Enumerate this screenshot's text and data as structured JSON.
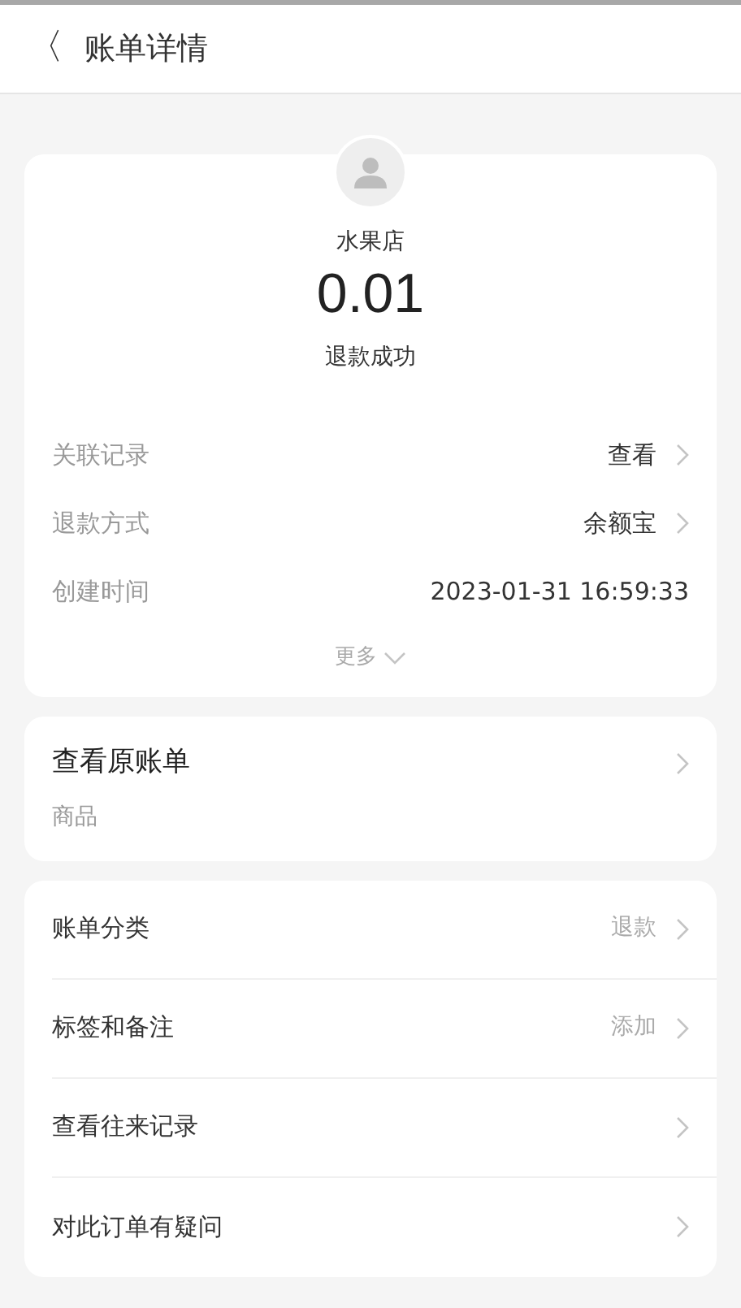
{
  "header": {
    "back_icon": "〈",
    "title": "账单详情"
  },
  "summary": {
    "merchant": "水果店",
    "amount": "0.01",
    "status": "退款成功"
  },
  "details": [
    {
      "label": "关联记录",
      "value": "查看",
      "has_arrow": true
    },
    {
      "label": "退款方式",
      "value": "余额宝",
      "has_arrow": true
    },
    {
      "label": "创建时间",
      "value": "2023-01-31 16:59:33",
      "has_arrow": false
    }
  ],
  "more": "更多",
  "original_bill": {
    "title": "查看原账单",
    "subtitle": "商品"
  },
  "actions": [
    {
      "label": "账单分类",
      "value": "退款"
    },
    {
      "label": "标签和备注",
      "value": "添加"
    },
    {
      "label": "查看往来记录"
    },
    {
      "label": "对此订单有疑问"
    }
  ]
}
